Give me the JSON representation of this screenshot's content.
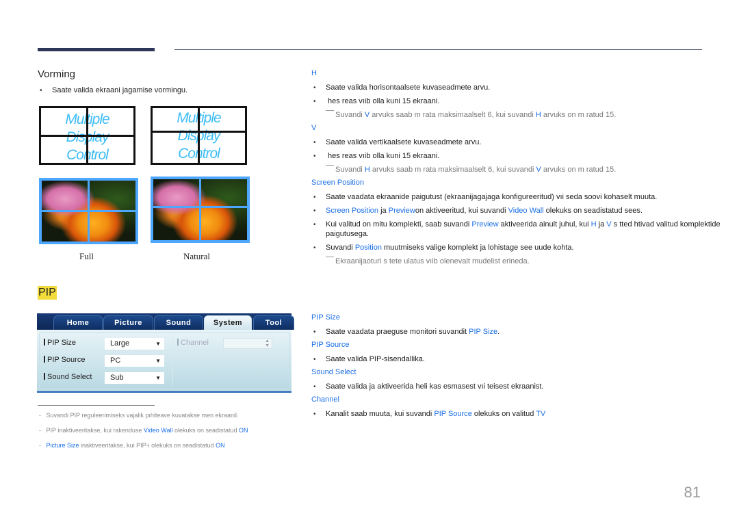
{
  "header": {
    "decor": "page-header-rule"
  },
  "vorming": {
    "title": "Vorming",
    "bullet": "Saate valida ekraani jagamise vormingu.",
    "mdc_words": [
      "Multiple",
      "Display",
      "Control"
    ],
    "captions": {
      "full": "Full",
      "natural": "Natural"
    }
  },
  "h_section": {
    "title": "H",
    "bullets": [
      "Saate valida horisontaalsete kuvaseadmete arvu.",
      " hes reas vıib olla kuni 15 ekraani."
    ],
    "note": {
      "p1": "Suvandi ",
      "k1": "V",
      "p2": " arvuks saab m  rata maksimaalselt 6, kui suvandi ",
      "k2": "H",
      "p3": " arvuks on m  ratud 15."
    }
  },
  "v_section": {
    "title": "V",
    "bullets": [
      "Saate valida vertikaalsete kuvaseadmete arvu.",
      " hes reas vıib olla kuni 15 ekraani."
    ],
    "note": {
      "p1": "Suvandi ",
      "k1": "H",
      "p2": " arvuks saab m  rata maksimaalselt 6, kui suvandi ",
      "k2": "V",
      "p3": " arvuks on m  ratud 15."
    }
  },
  "screen_position": {
    "title": "Screen Position",
    "b1": "Saate vaadata ekraanide paigutust (ekraanijagajaga konfigureeritud) vıi seda soovi kohaselt muuta.",
    "b2": {
      "k1": "Screen Position",
      "p1": " ja ",
      "k2": "Preview",
      "p2": "on aktiveeritud, kui suvandi ",
      "k3": "Video Wall",
      "p3": " olekuks on seadistatud sees."
    },
    "b3": {
      "p1": "Kui valitud on mitu komplekti, saab suvandi ",
      "k1": "Preview",
      "p2": " aktiveerida ainult juhul, kui ",
      "k2": "H",
      "p3": " ja ",
      "k3": "V",
      "p4": " s tted  htivad valitud komplektide",
      "p5": "paigutusega."
    },
    "b4": {
      "p1": "Suvandi ",
      "k1": "Position",
      "p2": " muutmiseks valige komplekt ja lohistage see uude kohta."
    },
    "note": "Ekraanijaoturi s tete ulatus vıib olenevalt mudelist erineda."
  },
  "pip": {
    "title": "PIP",
    "ui": {
      "tabs": [
        "Home",
        "Picture",
        "Sound",
        "System",
        "Tool"
      ],
      "active_tab": "System",
      "fields": [
        {
          "label": "PIP Size",
          "value": "Large"
        },
        {
          "label": "PIP Source",
          "value": "PC"
        },
        {
          "label": "Sound Select",
          "value": "Sub"
        }
      ],
      "channel_label": "Channel",
      "channel_value": ""
    },
    "items": {
      "size": {
        "title": "PIP Size",
        "p1": "Saate vaadata praeguse monitori suvandit ",
        "k1": "PIP Size",
        "p2": "."
      },
      "source": {
        "title": "PIP Source",
        "text": "Saate valida PIP-sisendallika."
      },
      "sound": {
        "title": "Sound Select",
        "text": "Saate valida ja aktiveerida heli kas esmasest vıi teisest ekraanist."
      },
      "channel": {
        "title": "Channel",
        "p1": "Kanalit saab muuta, kui suvandi ",
        "k1": "PIP Source",
        "p2": " olekuks on valitud ",
        "k2": "TV"
      }
    },
    "footnotes": {
      "f1": "Suvandi PIP reguleerimiseks vajalik pıhiteave kuvatakse men  ekraanil.",
      "f2": {
        "p1": "PIP inaktiveeritakse, kui rakenduse ",
        "k1": "Video Wall",
        "p2": " olekuks on seadistatud ",
        "k2": "ON"
      },
      "f3": {
        "k1": "Picture Size",
        "p1": " inaktiveeritakse, kui PIP-i olekuks on seadistatud ",
        "k2": "ON"
      }
    }
  },
  "page_number": "81",
  "bullet_glyph": "•"
}
